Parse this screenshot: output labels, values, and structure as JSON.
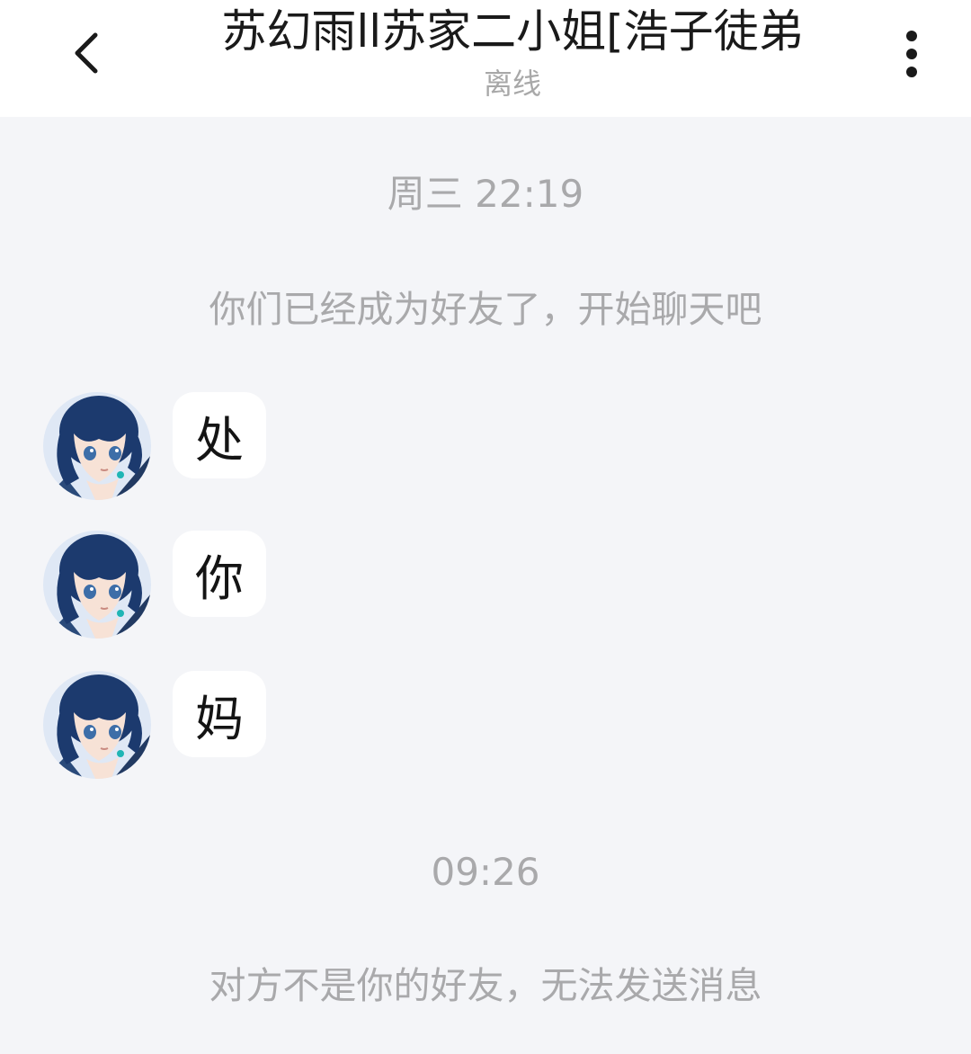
{
  "header": {
    "title": "苏幻雨ll苏家二小姐[浩子徒弟",
    "status": "离线",
    "back_icon": "chevron-left-icon",
    "more_icon": "more-vertical-icon"
  },
  "chat": {
    "timestamp_1": "周三 22:19",
    "system_note_1": "你们已经成为好友了，开始聊天吧",
    "messages": [
      {
        "text": "处",
        "avatar_icon": "anime-girl-avatar"
      },
      {
        "text": "你",
        "avatar_icon": "anime-girl-avatar"
      },
      {
        "text": "妈",
        "avatar_icon": "anime-girl-avatar"
      }
    ],
    "timestamp_2": "09:26",
    "system_note_2": "对方不是你的好友，无法发送消息"
  },
  "colors": {
    "page_bg": "#f4f5f8",
    "header_bg": "#ffffff",
    "bubble_bg": "#ffffff",
    "system_text": "#a9a9ab",
    "hair": "#1c3a6e"
  }
}
